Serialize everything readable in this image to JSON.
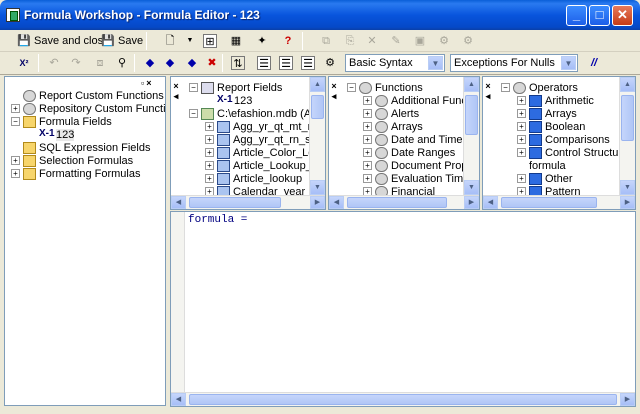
{
  "window": {
    "title": "Formula Workshop - Formula Editor - 123",
    "min_symbol": "_",
    "max_symbol": "□",
    "close_symbol": "✕"
  },
  "toolbar1": {
    "save_close_label": "Save and close",
    "save_label": "Save"
  },
  "toolbar2": {
    "syntax_value": "Basic Syntax",
    "nulls_value": "Exceptions For Nulls"
  },
  "workshop_tree": {
    "items": [
      {
        "label": "Report Custom Functions",
        "icon": "function-folder-icon"
      },
      {
        "label": "Repository Custom Functions",
        "icon": "function-folder-icon"
      },
      {
        "label": "Formula Fields",
        "icon": "folder-icon"
      },
      {
        "label": "123",
        "icon": "x1-formula-icon",
        "prefix": "X-1"
      },
      {
        "label": "SQL Expression Fields",
        "icon": "folder-icon"
      },
      {
        "label": "Selection Formulas",
        "icon": "folder-icon"
      },
      {
        "label": "Formatting Formulas",
        "icon": "folder-icon"
      }
    ]
  },
  "fields_tree": {
    "items": [
      {
        "label": "Report Fields"
      },
      {
        "label": "123",
        "prefix": "X-1"
      },
      {
        "label": "C:\\efashion.mdb (Acce"
      },
      {
        "label": "Agg_yr_qt_mt_mn_"
      },
      {
        "label": "Agg_yr_qt_rn_st_ln"
      },
      {
        "label": "Article_Color_Lookup"
      },
      {
        "label": "Article_Lookup_Cri"
      },
      {
        "label": "Article_lookup"
      },
      {
        "label": "Calendar_year_loo"
      }
    ]
  },
  "functions_tree": {
    "items": [
      {
        "label": "Functions"
      },
      {
        "label": "Additional Functions"
      },
      {
        "label": "Alerts"
      },
      {
        "label": "Arrays"
      },
      {
        "label": "Date and Time"
      },
      {
        "label": "Date Ranges"
      },
      {
        "label": "Document Properties"
      },
      {
        "label": "Evaluation Time"
      },
      {
        "label": "Financial"
      }
    ]
  },
  "operators_tree": {
    "items": [
      {
        "label": "Operators"
      },
      {
        "label": "Arithmetic"
      },
      {
        "label": "Arrays"
      },
      {
        "label": "Boolean"
      },
      {
        "label": "Comparisons"
      },
      {
        "label": "Control Structures"
      },
      {
        "label": "formula"
      },
      {
        "label": "Other"
      },
      {
        "label": "Pattern"
      }
    ]
  },
  "editor": {
    "text": "formula ="
  }
}
